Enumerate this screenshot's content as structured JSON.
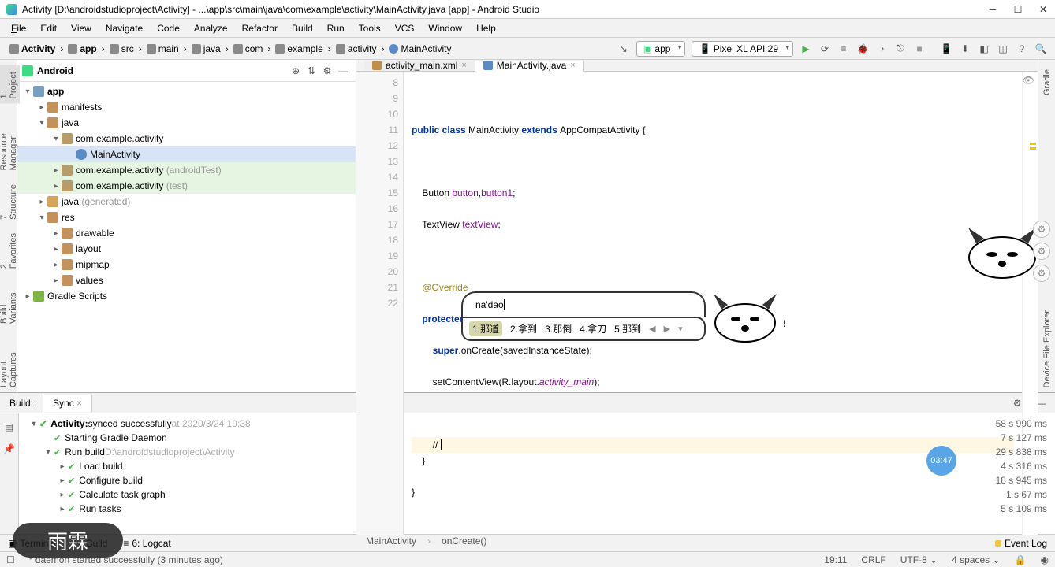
{
  "title": "Activity [D:\\androidstudioproject\\Activity] - ...\\app\\src\\main\\java\\com\\example\\activity\\MainActivity.java [app] - Android Studio",
  "menu": {
    "file": "File",
    "edit": "Edit",
    "view": "View",
    "navigate": "Navigate",
    "code": "Code",
    "analyze": "Analyze",
    "refactor": "Refactor",
    "build": "Build",
    "run": "Run",
    "tools": "Tools",
    "vcs": "VCS",
    "window": "Window",
    "help": "Help"
  },
  "crumbs": [
    "Activity",
    "app",
    "src",
    "main",
    "java",
    "com",
    "example",
    "activity",
    "MainActivity"
  ],
  "run_config": "app",
  "device": "Pixel XL API 29",
  "project_view": "Android",
  "tree": {
    "app": "app",
    "manifests": "manifests",
    "java": "java",
    "pkg1": "com.example.activity",
    "main_act": "MainActivity",
    "pkg2": "com.example.activity",
    "pkg2_suffix": "(androidTest)",
    "pkg3": "com.example.activity",
    "pkg3_suffix": "(test)",
    "java_gen": "java",
    "java_gen_suffix": "(generated)",
    "res": "res",
    "drawable": "drawable",
    "layout": "layout",
    "mipmap": "mipmap",
    "values": "values",
    "gradle": "Gradle Scripts"
  },
  "tabs": {
    "xml": "activity_main.xml",
    "java": "MainActivity.java"
  },
  "gutter": [
    "8",
    "9",
    "10",
    "11",
    "12",
    "13",
    "14",
    "15",
    "16",
    "17",
    "18",
    "19",
    "20",
    "21",
    "22"
  ],
  "code": {
    "l9a": "public class ",
    "l9b": "MainActivity ",
    "l9c": "extends ",
    "l9d": "AppCompatActivity {",
    "l11a": "    Button ",
    "l11b": "button",
    "l11c": ",",
    "l11d": "button1",
    "l11e": ";",
    "l12a": "    TextView ",
    "l12b": "textView",
    "l12c": ";",
    "l14": "    @Override",
    "l15a": "    protected void ",
    "l15b": "onCreate",
    "l15c": "(Bundle savedInstanceState) {",
    "l16a": "        super",
    "l16b": ".onCreate(savedInstanceState);",
    "l17a": "        setContentView(R.layout.",
    "l17b": "activity_main",
    "l17c": ");",
    "l19": "        //",
    "l20": "    }",
    "l21": "}"
  },
  "breadcrumb2": {
    "a": "MainActivity",
    "b": "onCreate()"
  },
  "ime": {
    "input": "na'dao",
    "cands": [
      {
        "n": "1.",
        "t": "那道"
      },
      {
        "n": "2.",
        "t": "拿到"
      },
      {
        "n": "3.",
        "t": "那倒"
      },
      {
        "n": "4.",
        "t": "拿刀"
      },
      {
        "n": "5.",
        "t": "那到"
      }
    ]
  },
  "build": {
    "tab_build": "Build:",
    "tab_sync": "Sync",
    "root": "Activity:",
    "root_status": "synced successfully",
    "root_time": "at 2020/3/24 19:38",
    "r1": "Starting Gradle Daemon",
    "r2": "Run build",
    "r2_path": "D:\\androidstudioproject\\Activity",
    "r3": "Load build",
    "r4": "Configure build",
    "r5": "Calculate task graph",
    "r6": "Run tasks",
    "times": [
      "58 s 990 ms",
      "7 s 127 ms",
      "29 s 838 ms",
      "4 s 316 ms",
      "18 s 945 ms",
      "1 s 67 ms",
      "5 s 109 ms"
    ]
  },
  "timer": "03:47",
  "bottom_tools": {
    "terminal": "Terminal",
    "build": "Build",
    "logcat": "6: Logcat",
    "eventlog": "Event Log"
  },
  "status": {
    "msg": "* daemon started successfully (3 minutes ago)",
    "pos": "19:11",
    "crlf": "CRLF",
    "enc": "UTF-8",
    "indent": "4 spaces"
  },
  "brand": "雨霖",
  "left_tabs": {
    "project": "1: Project",
    "rm": "Resource Manager",
    "structure": "7: Structure",
    "fav": "2: Favorites",
    "bv": "Build Variants",
    "lc": "Layout Captures"
  },
  "right_tabs": {
    "gradle": "Gradle",
    "dfe": "Device File Explorer"
  }
}
